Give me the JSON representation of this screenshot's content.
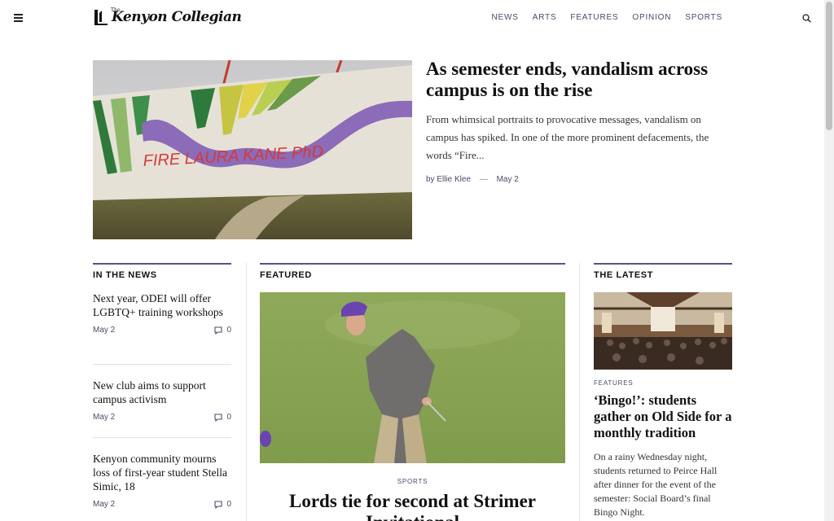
{
  "header": {
    "logo_text": "Kenyon Collegian",
    "logo_the": "The",
    "nav": [
      "NEWS",
      "ARTS",
      "FEATURES",
      "OPINION",
      "SPORTS"
    ]
  },
  "hero": {
    "title": "As semester ends, vandalism across campus is on the rise",
    "excerpt": "From whimsical portraits to provocative messages, vandalism on campus has spiked. In one of the more prominent defacements, the words “Fire...",
    "author": "by Ellie Klee",
    "date": "May 2",
    "image_graffiti_text": "FIRE LAURA KANE PhD"
  },
  "in_the_news": {
    "heading": "IN THE NEWS",
    "items": [
      {
        "title": "Next year, ODEI will offer LGBTQ+ training workshops",
        "date": "May 2",
        "comments": "0"
      },
      {
        "title": "New club aims to support campus activism",
        "date": "May 2",
        "comments": "0"
      },
      {
        "title": "Kenyon community mourns loss of first-year student Stella Simic, 18",
        "date": "May 2",
        "comments": "0"
      }
    ]
  },
  "featured": {
    "heading": "FEATURED",
    "category": "SPORTS",
    "title": "Lords tie for second at Strimer Invitational"
  },
  "latest": {
    "heading": "THE LATEST",
    "category": "FEATURES",
    "title": "‘Bingo!’: students gather on Old Side for a monthly tradition",
    "excerpt": "On a rainy Wednesday night, students returned to Peirce Hall after dinner for the event of the semester: Social Board’s final Bingo Night."
  },
  "colors": {
    "accent": "#5c4f8a",
    "meta": "#4a4a6a"
  }
}
